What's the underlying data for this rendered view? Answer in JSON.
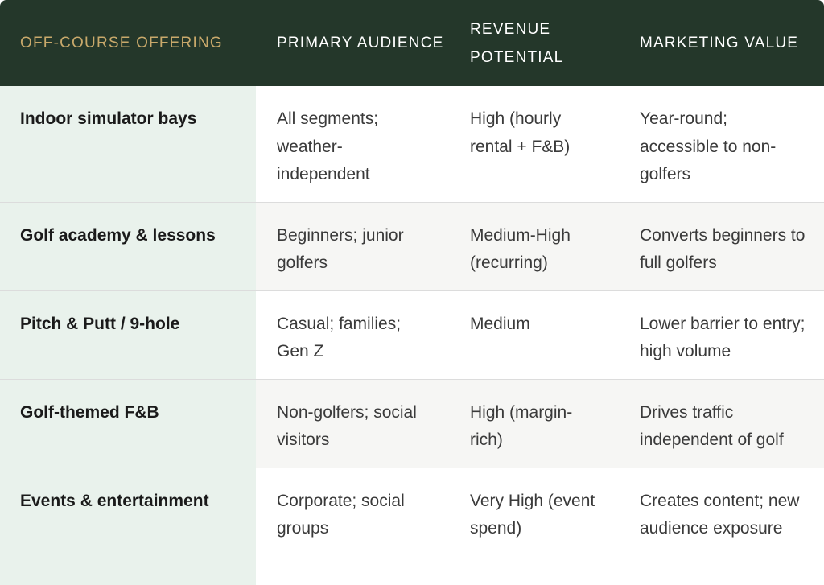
{
  "table": {
    "headers": [
      "OFF-COURSE OFFERING",
      "PRIMARY AUDIENCE",
      "REVENUE POTENTIAL",
      "MARKETING VALUE"
    ],
    "rows": [
      {
        "offering": "Indoor simulator bays",
        "audience": "All segments; weather-independent",
        "revenue": "High (hourly rental + F&B)",
        "marketing": "Year-round; accessible to non-golfers"
      },
      {
        "offering": "Golf academy & lessons",
        "audience": "Beginners; junior golfers",
        "revenue": "Medium-High (recurring)",
        "marketing": "Converts beginners to full golfers"
      },
      {
        "offering": "Pitch & Putt / 9-hole",
        "audience": "Casual; families; Gen Z",
        "revenue": "Medium",
        "marketing": "Lower barrier to entry; high volume"
      },
      {
        "offering": "Golf-themed F&B",
        "audience": "Non-golfers; social visitors",
        "revenue": "High (margin-rich)",
        "marketing": "Drives traffic independent of golf"
      },
      {
        "offering": "Events & entertainment",
        "audience": "Corporate; social groups",
        "revenue": "Very High (event spend)",
        "marketing": "Creates content; new audience exposure"
      }
    ]
  },
  "colors": {
    "header_bg": "#24372a",
    "header_first_text": "#c9a96b",
    "label_col_bg": "#e9f2ec"
  }
}
